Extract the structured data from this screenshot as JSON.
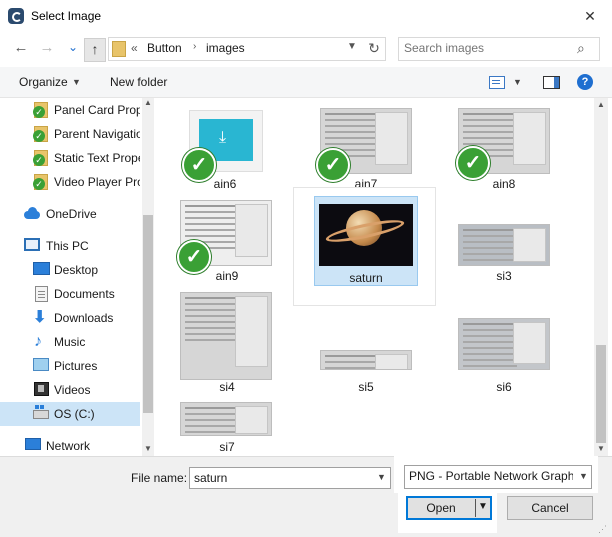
{
  "window": {
    "title": "Select Image",
    "close_glyph": "✕"
  },
  "nav": {
    "back_glyph": "←",
    "forward_glyph": "→",
    "recent_glyph": "⌄",
    "up_glyph": "↑",
    "address_prefix": "«",
    "breadcrumbs": [
      "Button",
      "images"
    ],
    "breadcrumb_separator": "›",
    "refresh_glyph": "↻",
    "search_placeholder": "Search images",
    "search_glyph": "⌕"
  },
  "toolbar": {
    "organize_label": "Organize",
    "new_folder_label": "New folder",
    "help_glyph": "?"
  },
  "sidebar": {
    "items": [
      {
        "label": "Panel Card Prop",
        "icon": "folder-check-icon"
      },
      {
        "label": "Parent Navigatio",
        "icon": "folder-check-icon"
      },
      {
        "label": "Static Text Prope",
        "icon": "folder-check-icon"
      },
      {
        "label": "Video Player Pro",
        "icon": "folder-check-icon"
      },
      {
        "label": "OneDrive",
        "icon": "onedrive-icon"
      },
      {
        "label": "This PC",
        "icon": "pc-icon"
      },
      {
        "label": "Desktop",
        "icon": "desktop-icon"
      },
      {
        "label": "Documents",
        "icon": "documents-icon"
      },
      {
        "label": "Downloads",
        "icon": "downloads-icon"
      },
      {
        "label": "Music",
        "icon": "music-icon"
      },
      {
        "label": "Pictures",
        "icon": "pictures-icon"
      },
      {
        "label": "Videos",
        "icon": "videos-icon"
      },
      {
        "label": "OS (C:)",
        "icon": "drive-icon"
      },
      {
        "label": "Network",
        "icon": "network-icon"
      }
    ],
    "selected": "OS (C:)"
  },
  "files": [
    {
      "name": "ain6",
      "synced": true
    },
    {
      "name": "ain7",
      "synced": true
    },
    {
      "name": "ain8",
      "synced": true
    },
    {
      "name": "ain9",
      "synced": true
    },
    {
      "name": "saturn",
      "synced": false,
      "selected": true
    },
    {
      "name": "si3",
      "synced": false
    },
    {
      "name": "si4",
      "synced": false
    },
    {
      "name": "si5",
      "synced": false
    },
    {
      "name": "si6",
      "synced": false
    },
    {
      "name": "si7",
      "synced": false
    }
  ],
  "bottom": {
    "file_name_label": "File name:",
    "file_name_value": "saturn",
    "file_type_value": "PNG - Portable Network Graphi",
    "open_label": "Open",
    "open_arrow": "▼",
    "cancel_label": "Cancel"
  },
  "colors": {
    "accent": "#0078d7",
    "selection": "#cce4f7",
    "sync_check": "#3aa035"
  }
}
